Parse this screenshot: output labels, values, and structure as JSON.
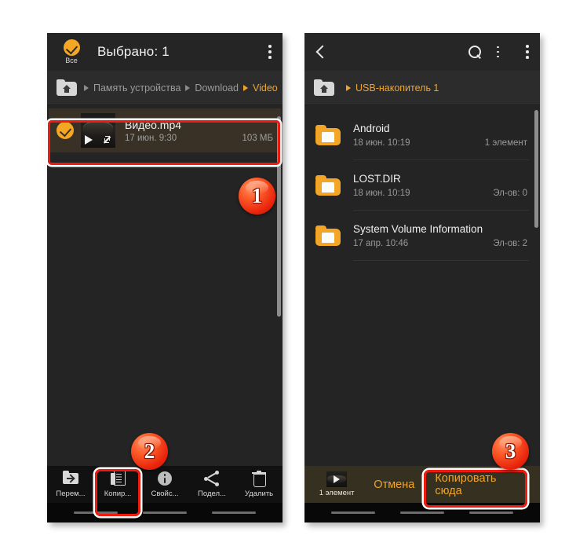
{
  "left_phone": {
    "appbar": {
      "select_all_label": "Все",
      "select_all_icon": "check-circle-icon",
      "title": "Выбрано: 1",
      "overflow_icon": "more-vertical-icon"
    },
    "breadcrumb": {
      "home_icon": "home-folder-icon",
      "items": [
        {
          "label": "Память устройства",
          "current": false
        },
        {
          "label": "Download",
          "current": false
        },
        {
          "label": "Video",
          "current": true
        }
      ]
    },
    "file": {
      "selected": true,
      "check_icon": "check-circle-icon",
      "thumbnail_icon": "video-thumbnail",
      "play_icon": "play-icon",
      "expand_icon": "expand-arrows-icon",
      "name": "Видео.mp4",
      "date": "17 июн. 9:30",
      "size": "103 МБ"
    },
    "toolbar": [
      {
        "label": "Перем...",
        "icon": "move-folder-icon"
      },
      {
        "label": "Копир...",
        "icon": "copy-sheets-icon",
        "highlighted": true
      },
      {
        "label": "Свойс...",
        "icon": "info-icon"
      },
      {
        "label": "Подел...",
        "icon": "share-icon"
      },
      {
        "label": "Удалить",
        "icon": "trash-icon"
      }
    ]
  },
  "right_phone": {
    "appbar": {
      "back_icon": "back-arrow-icon",
      "search_icon": "search-icon",
      "sort_icon": "sort-list-icon",
      "overflow_icon": "more-vertical-icon"
    },
    "breadcrumb": {
      "home_icon": "home-folder-icon",
      "items": [
        {
          "label": "USB-накопитель 1",
          "current": true
        }
      ]
    },
    "folders": [
      {
        "name": "Android",
        "date": "18 июн. 10:19",
        "count": "1 элемент",
        "icon": "folder-icon"
      },
      {
        "name": "LOST.DIR",
        "date": "18 июн. 10:19",
        "count": "Эл-ов: 0",
        "icon": "folder-icon"
      },
      {
        "name": "System Volume Information",
        "date": "17 апр. 10:46",
        "count": "Эл-ов: 2",
        "icon": "folder-icon"
      }
    ],
    "action_bar": {
      "thumbnail_icon": "video-thumbnail",
      "selection_count": "1 элемент",
      "cancel_label": "Отмена",
      "copy_here_label": "Копировать сюда"
    }
  },
  "badges": [
    {
      "number": "1"
    },
    {
      "number": "2"
    },
    {
      "number": "3"
    }
  ],
  "colors": {
    "accent": "#f0a52a",
    "panel_bg": "#242424",
    "selected_row": "#3a3126",
    "highlight": "#ee1b11",
    "action_bar": "#35301f"
  }
}
